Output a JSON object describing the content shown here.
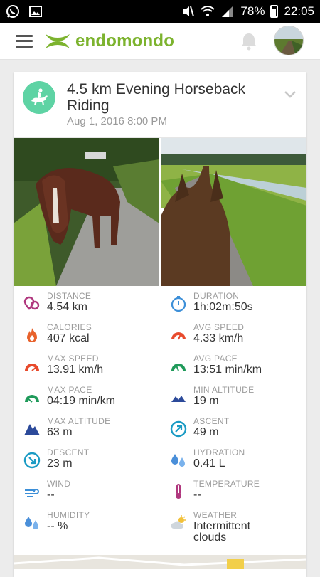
{
  "status_bar": {
    "battery": "78%",
    "time": "22:05"
  },
  "app": {
    "name": "endomondo",
    "brand_color": "#7cb32e"
  },
  "activity": {
    "title": "4.5 km Evening Horseback Riding",
    "date": "Aug 1, 2016 8:00 PM",
    "sport_icon": "horse-riding-icon",
    "sport_color": "#5ed3a4"
  },
  "stats": [
    {
      "label": "DISTANCE",
      "value": "4.54 km",
      "icon": "distance-pins-icon"
    },
    {
      "label": "DURATION",
      "value": "1h:02m:50s",
      "icon": "stopwatch-icon"
    },
    {
      "label": "CALORIES",
      "value": "407 kcal",
      "icon": "flame-icon"
    },
    {
      "label": "AVG SPEED",
      "value": "4.33 km/h",
      "icon": "speedometer-icon"
    },
    {
      "label": "MAX SPEED",
      "value": "13.91 km/h",
      "icon": "max-speed-icon"
    },
    {
      "label": "AVG PACE",
      "value": "13:51 min/km",
      "icon": "avg-pace-icon"
    },
    {
      "label": "MAX PACE",
      "value": "04:19 min/km",
      "icon": "max-pace-icon"
    },
    {
      "label": "MIN ALTITUDE",
      "value": "19 m",
      "icon": "min-altitude-icon"
    },
    {
      "label": "MAX ALTITUDE",
      "value": "63 m",
      "icon": "max-altitude-icon"
    },
    {
      "label": "ASCENT",
      "value": "49 m",
      "icon": "ascent-icon"
    },
    {
      "label": "DESCENT",
      "value": "23 m",
      "icon": "descent-icon"
    },
    {
      "label": "HYDRATION",
      "value": "0.41 L",
      "icon": "water-drops-icon"
    },
    {
      "label": "WIND",
      "value": "--",
      "icon": "wind-icon"
    },
    {
      "label": "TEMPERATURE",
      "value": "--",
      "icon": "thermometer-icon"
    },
    {
      "label": "HUMIDITY",
      "value": "-- %",
      "icon": "humidity-icon"
    },
    {
      "label": "WEATHER",
      "value": "Intermittent",
      "value2": "clouds",
      "icon": "weather-cloud-sun-icon"
    }
  ]
}
